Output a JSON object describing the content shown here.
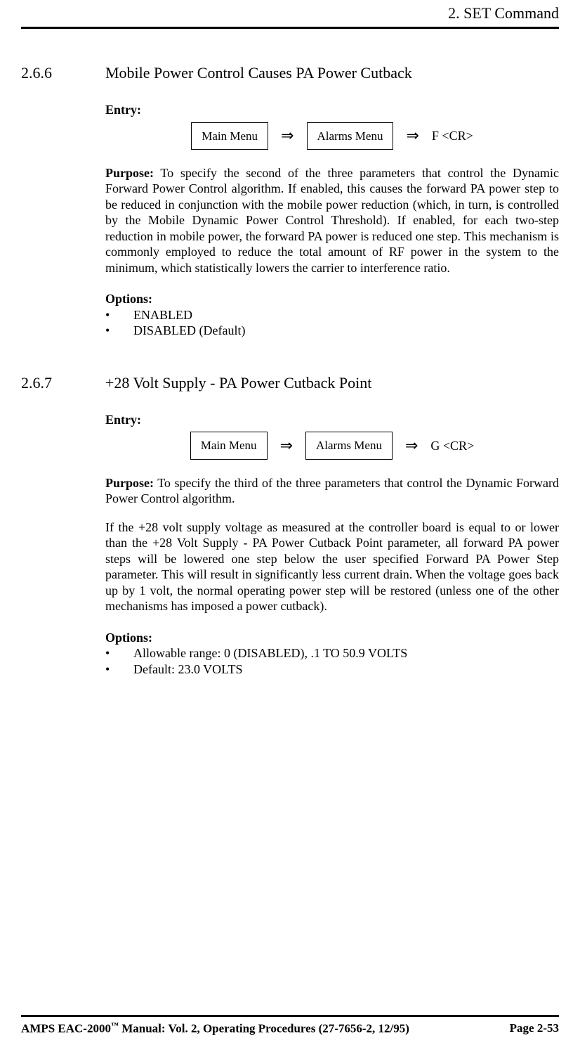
{
  "header": {
    "chapter": "2.  SET Command"
  },
  "sections": [
    {
      "number": "2.6.6",
      "title": "Mobile Power Control Causes PA Power Cutback",
      "entry_label": "Entry:",
      "entry": {
        "menu1": "Main Menu",
        "menu2": "Alarms Menu",
        "command": "F <CR>"
      },
      "purpose_label": "Purpose:",
      "purpose_text": "  To specify the second of the three parameters that control the Dynamic Forward Power Control algorithm.  If enabled, this causes the forward PA power step to be reduced in conjunction with the mobile power reduction (which, in turn, is controlled by the Mobile Dynamic Power Control Threshold). If enabled, for each two-step reduction in mobile power, the forward PA power is reduced one step.  This mechanism is commonly employed to reduce the total amount of RF power in the system to the minimum, which statistically lowers the carrier to interference ratio.",
      "options_label": "Options:",
      "options": [
        "ENABLED",
        "DISABLED (Default)"
      ]
    },
    {
      "number": "2.6.7",
      "title": "+28 Volt Supply - PA Power Cutback Point",
      "entry_label": "Entry:",
      "entry": {
        "menu1": "Main Menu",
        "menu2": "Alarms Menu",
        "command": "G <CR>"
      },
      "purpose_label": "Purpose:",
      "purpose_text": "  To specify the third of the three parameters that control the Dynamic Forward Power Control algorithm.",
      "extra_paragraph": "If the +28 volt supply voltage as measured at the controller board is equal to or lower than the +28 Volt Supply - PA Power Cutback Point parameter, all forward PA power steps will be lowered one step below the user specified Forward PA Power Step parameter.  This will result in significantly less current drain.  When the voltage goes back up by 1 volt, the normal operating power step will be restored (unless one of the other mechanisms has imposed a power cutback).",
      "options_label": "Options:",
      "options": [
        "Allowable range:  0 (DISABLED), .1 TO 50.9 VOLTS",
        "Default:  23.0 VOLTS"
      ]
    }
  ],
  "footer": {
    "left_prefix": "AMPS EAC-2000",
    "left_tm": "™",
    "left_suffix": " Manual:  Vol. 2, Operating Procedures (27-7656-2, 12/95)",
    "right": "Page 2-53"
  },
  "glyphs": {
    "arrow": "⇒",
    "bullet": "•"
  }
}
